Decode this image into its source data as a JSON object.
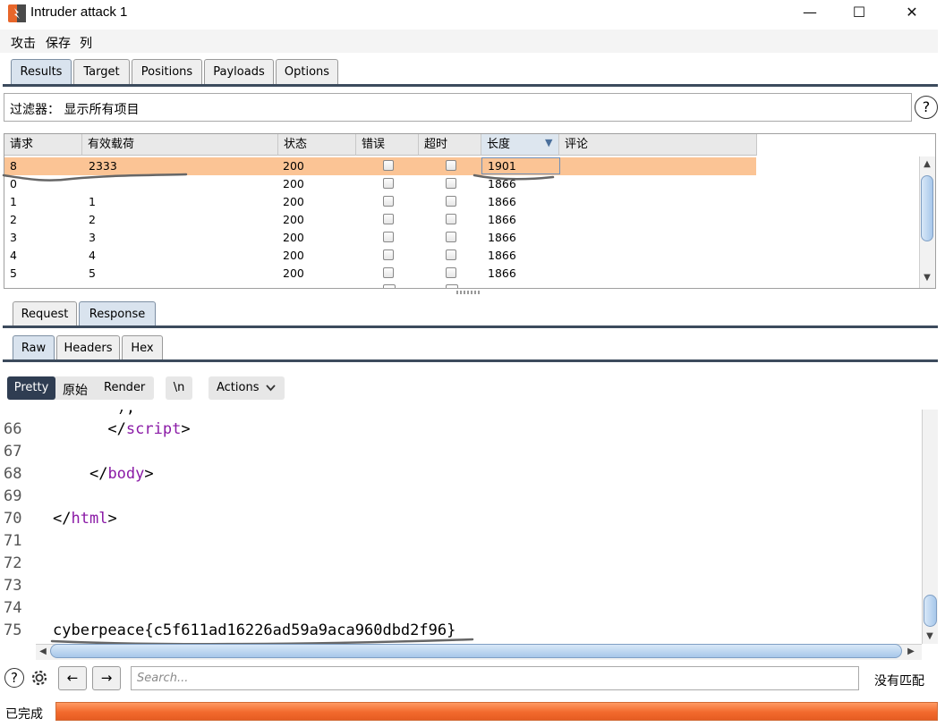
{
  "window": {
    "title": "Intruder attack 1",
    "minimize": "—",
    "maximize": "☐",
    "close": "✕"
  },
  "menu": [
    "攻击",
    "保存",
    "列"
  ],
  "tabs": [
    "Results",
    "Target",
    "Positions",
    "Payloads",
    "Options"
  ],
  "filter": {
    "text": "过滤器： 显示所有项目",
    "help": "?"
  },
  "table": {
    "columns": [
      "请求",
      "有效载荷",
      "状态",
      "错误",
      "超时",
      "长度",
      "评论"
    ],
    "sort_indicator": "▼",
    "rows": [
      {
        "req": "8",
        "payload": "2333",
        "status": "200",
        "length": "1901"
      },
      {
        "req": "0",
        "payload": "",
        "status": "200",
        "length": "1866"
      },
      {
        "req": "1",
        "payload": "1",
        "status": "200",
        "length": "1866"
      },
      {
        "req": "2",
        "payload": "2",
        "status": "200",
        "length": "1866"
      },
      {
        "req": "3",
        "payload": "3",
        "status": "200",
        "length": "1866"
      },
      {
        "req": "4",
        "payload": "4",
        "status": "200",
        "length": "1866"
      },
      {
        "req": "5",
        "payload": "5",
        "status": "200",
        "length": "1866"
      }
    ]
  },
  "reqres_tabs": [
    "Request",
    "Response"
  ],
  "view_tabs": [
    "Raw",
    "Headers",
    "Hex"
  ],
  "toolbar": {
    "pretty": "Pretty",
    "raw": "原始",
    "render": "Render",
    "newline": "\\n",
    "actions": "Actions"
  },
  "editor": {
    "lines": [
      {
        "n": "66",
        "indent": "      ",
        "open": "</",
        "tag": "script",
        "close": ">"
      },
      {
        "n": "67"
      },
      {
        "n": "68",
        "indent": "    ",
        "open": "</",
        "tag": "body",
        "close": ">"
      },
      {
        "n": "69"
      },
      {
        "n": "70",
        "indent": "  ",
        "open": "</",
        "tag": "html",
        "close": ">"
      },
      {
        "n": "71"
      },
      {
        "n": "72"
      },
      {
        "n": "73"
      },
      {
        "n": "74"
      },
      {
        "n": "75",
        "indent": "  ",
        "text": "cyberpeace{c5f611ad16226ad59a9aca960dbd2f96}"
      }
    ]
  },
  "search": {
    "placeholder": "Search...",
    "matches": "没有匹配",
    "prev": "←",
    "next": "→",
    "help": "?"
  },
  "status": {
    "text": "已完成",
    "progress": 1.0
  },
  "colors": {
    "selected_row": "#fbc495",
    "progress": "#f26a2d",
    "tag": "#8a1aa6",
    "active_tab": "#d9e3ee"
  }
}
